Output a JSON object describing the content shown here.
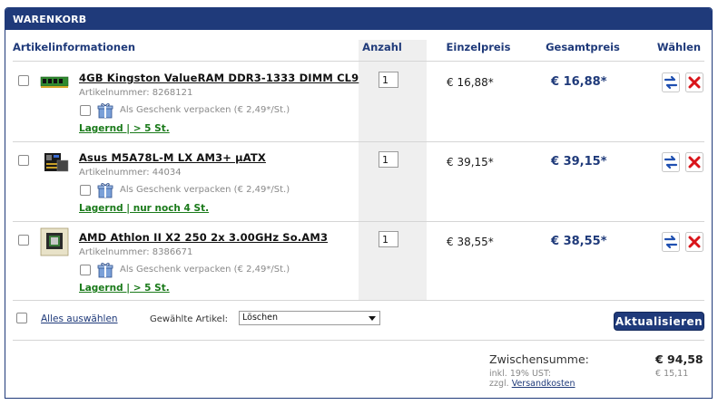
{
  "panel": {
    "title": "WARENKORB"
  },
  "columns": {
    "article": "Artikelinformationen",
    "quantity": "Anzahl",
    "unit_price": "Einzelpreis",
    "total_price": "Gesamtpreis",
    "select": "Wählen"
  },
  "items": [
    {
      "name": "4GB Kingston ValueRAM DDR3-1333 DIMM CL9",
      "article_number": "Artikelnummer: 8268121",
      "gift_text": "Als Geschenk verpacken (€ 2,49*/St.)",
      "stock": "Lagernd | > 5 St.",
      "quantity": "1",
      "unit_price": "€ 16,88*",
      "total_price": "€ 16,88*",
      "thumb_icon": "ram-module-icon"
    },
    {
      "name": "Asus M5A78L-M LX AM3+ µATX",
      "article_number": "Artikelnummer: 44034",
      "gift_text": "Als Geschenk verpacken (€ 2,49*/St.)",
      "stock": "Lagernd | nur noch 4 St.",
      "quantity": "1",
      "unit_price": "€ 39,15*",
      "total_price": "€ 39,15*",
      "thumb_icon": "motherboard-icon"
    },
    {
      "name": "AMD Athlon II X2 250 2x 3.00GHz So.AM3",
      "article_number": "Artikelnummer: 8386671",
      "gift_text": "Als Geschenk verpacken (€ 2,49*/St.)",
      "stock": "Lagernd | > 5 St.",
      "quantity": "1",
      "unit_price": "€ 38,55*",
      "total_price": "€ 38,55*",
      "thumb_icon": "cpu-box-icon"
    }
  ],
  "footer": {
    "select_all": "Alles auswählen",
    "selected_label": "Gewählte Artikel:",
    "action_value": "Löschen",
    "update_button": "Aktualisieren"
  },
  "summary": {
    "subtotal_label": "Zwischensumme:",
    "subtotal_value": "€ 94,58",
    "vat_label": "inkl. 19% UST:",
    "vat_value": "€ 15,11",
    "shipping_prefix": "zzgl.",
    "shipping_link": "Versandkosten"
  },
  "colors": {
    "brand": "#1f3a7a",
    "stock_green": "#1a7a1a",
    "delete_red": "#d9141a"
  }
}
